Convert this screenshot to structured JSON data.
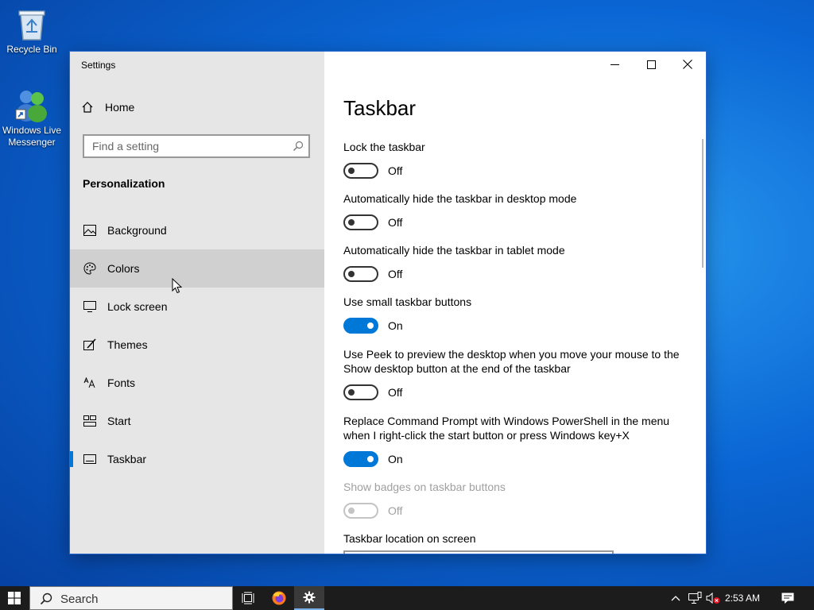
{
  "desktop": {
    "icons": [
      {
        "label": "Recycle Bin",
        "icon": "recycle-bin-icon"
      },
      {
        "label": "Windows Live Messenger",
        "icon": "messenger-icon"
      }
    ]
  },
  "window": {
    "title": "Settings",
    "controls": {
      "minimize": "minimize-icon",
      "maximize": "maximize-icon",
      "close": "close-icon"
    }
  },
  "sidebar": {
    "home_label": "Home",
    "search_placeholder": "Find a setting",
    "section_title": "Personalization",
    "items": [
      {
        "label": "Background",
        "icon": "picture-icon"
      },
      {
        "label": "Colors",
        "icon": "palette-icon"
      },
      {
        "label": "Lock screen",
        "icon": "monitor-icon"
      },
      {
        "label": "Themes",
        "icon": "brush-icon"
      },
      {
        "label": "Fonts",
        "icon": "font-icon"
      },
      {
        "label": "Start",
        "icon": "start-tiles-icon"
      },
      {
        "label": "Taskbar",
        "icon": "taskbar-icon"
      }
    ],
    "hovered_item": "Colors",
    "selected_item": "Taskbar"
  },
  "content": {
    "page_title": "Taskbar",
    "settings": [
      {
        "label": "Lock the taskbar",
        "state": "Off",
        "on": false,
        "disabled": false
      },
      {
        "label": "Automatically hide the taskbar in desktop mode",
        "state": "Off",
        "on": false,
        "disabled": false
      },
      {
        "label": "Automatically hide the taskbar in tablet mode",
        "state": "Off",
        "on": false,
        "disabled": false
      },
      {
        "label": "Use small taskbar buttons",
        "state": "On",
        "on": true,
        "disabled": false
      },
      {
        "label_line1": "Use Peek to preview the desktop when you move your mouse to the",
        "label_line2": "Show desktop button at the end of the taskbar",
        "state": "Off",
        "on": false,
        "disabled": false
      },
      {
        "label_line1": "Replace Command Prompt with Windows PowerShell in the menu",
        "label_line2": "when I right-click the start button or press Windows key+X",
        "state": "On",
        "on": true,
        "disabled": false
      },
      {
        "label": "Show badges on taskbar buttons",
        "state": "Off",
        "on": false,
        "disabled": true
      }
    ],
    "location_label": "Taskbar location on screen"
  },
  "taskbar": {
    "search_label": "Search",
    "clock": "2:53 AM",
    "accent": "#0078d7"
  }
}
